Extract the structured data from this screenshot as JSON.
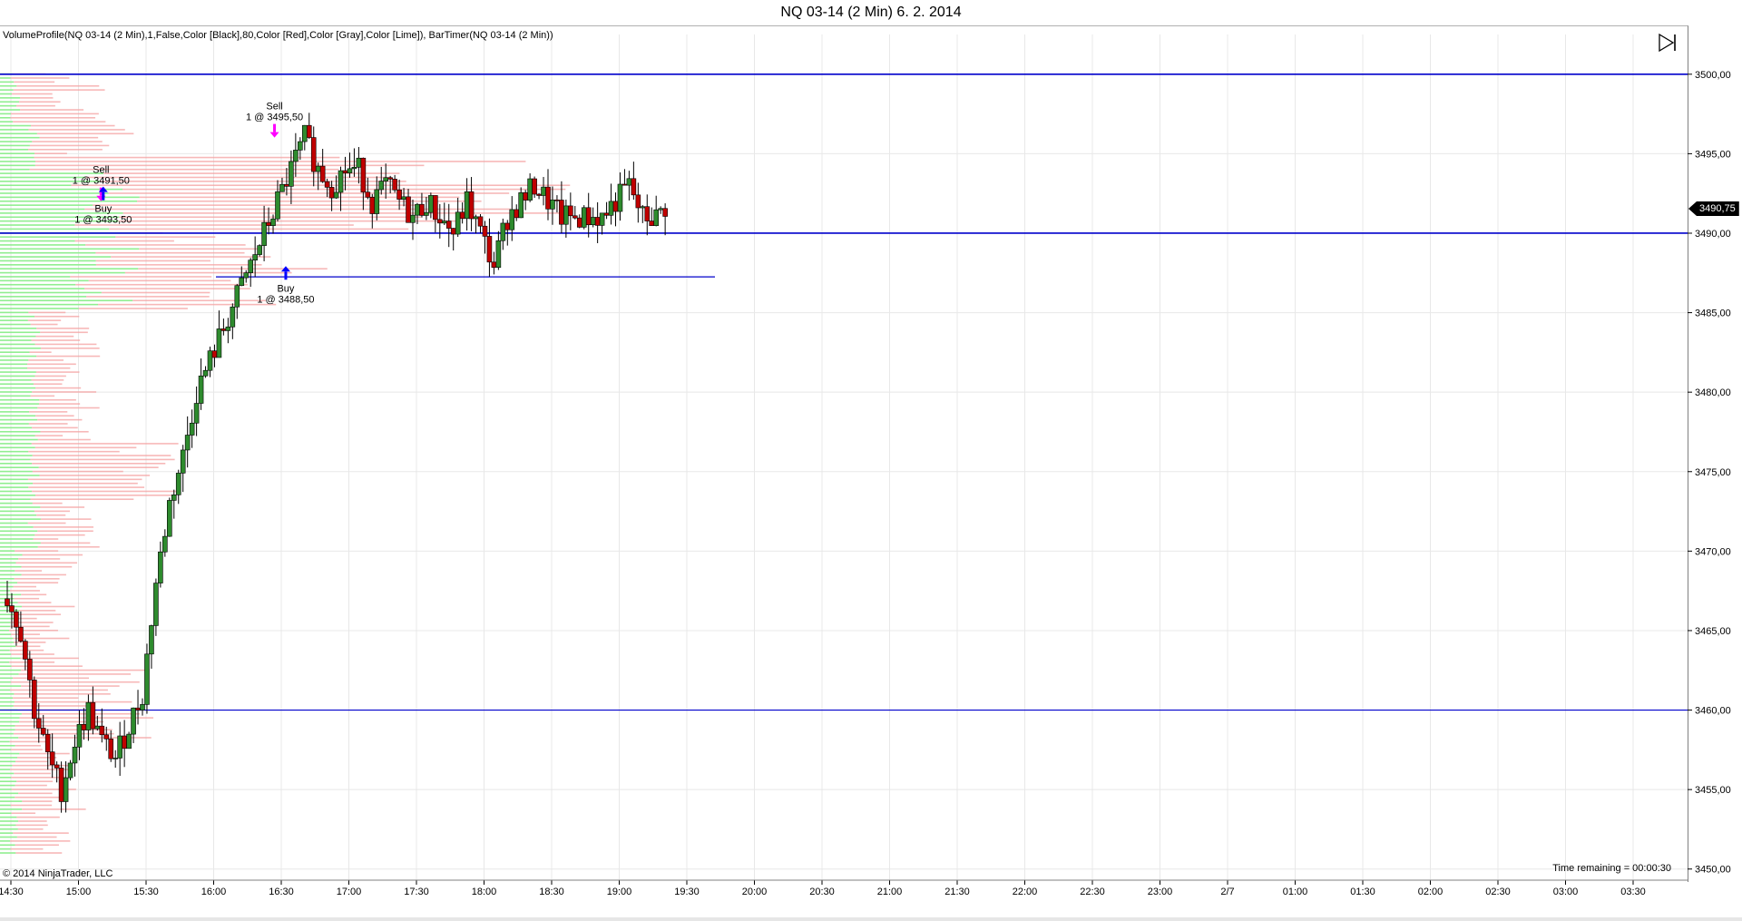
{
  "window": {
    "title": "NQ 03-14 (2 Min)  6. 2. 2014"
  },
  "chart": {
    "indicator_label": "VolumeProfile(NQ 03-14 (2 Min),1,False,Color [Black],80,Color [Red],Color [Gray],Color [Lime]), BarTimer(NQ 03-14 (2 Min))",
    "copyright": "© 2014 NinjaTrader, LLC",
    "time_remaining": "Time remaining = 00:00:30",
    "current_price_label": "3490,75",
    "nav_icon": "skip-to-end-icon",
    "colors": {
      "up_bar": "#2e8b2e",
      "down_bar": "#c00000",
      "profile_buy": "#90ee90",
      "profile_sell": "#f4a0a0",
      "hline": "#0000cc",
      "sell_marker": "#ff00ff",
      "buy_marker": "#0000ff"
    }
  },
  "chart_data": {
    "type": "candlestick",
    "price_axis_ticks": [
      "3500,00",
      "3495,00",
      "3490,00",
      "3485,00",
      "3480,00",
      "3475,00",
      "3470,00",
      "3465,00",
      "3460,00",
      "3455,00",
      "3450,00"
    ],
    "price_axis_values": [
      3500,
      3495,
      3490,
      3485,
      3480,
      3475,
      3470,
      3465,
      3460,
      3455,
      3450
    ],
    "time_axis_ticks": [
      "14:30",
      "15:00",
      "15:30",
      "16:00",
      "16:30",
      "17:00",
      "17:30",
      "18:00",
      "18:30",
      "19:00",
      "19:30",
      "20:00",
      "20:30",
      "21:00",
      "21:30",
      "22:00",
      "22:30",
      "23:00",
      "2/7",
      "01:00",
      "01:30",
      "02:00",
      "02:30",
      "03:00",
      "03:30"
    ],
    "ylim": [
      3449.3,
      3502.5
    ],
    "horizontal_lines": [
      3500.0,
      3490.0,
      3460.0,
      3487.25
    ],
    "close_path": [
      [
        0,
        3467
      ],
      [
        6,
        3465
      ],
      [
        12,
        3460
      ],
      [
        18,
        3457
      ],
      [
        24,
        3455
      ],
      [
        30,
        3458
      ],
      [
        36,
        3460
      ],
      [
        42,
        3458
      ],
      [
        48,
        3457
      ],
      [
        54,
        3459
      ],
      [
        60,
        3461
      ],
      [
        66,
        3468
      ],
      [
        72,
        3473
      ],
      [
        78,
        3476
      ],
      [
        84,
        3480
      ],
      [
        90,
        3482
      ],
      [
        96,
        3484
      ],
      [
        102,
        3486
      ],
      [
        108,
        3488
      ],
      [
        114,
        3490
      ],
      [
        120,
        3492
      ],
      [
        126,
        3494
      ],
      [
        132,
        3496
      ],
      [
        138,
        3494
      ],
      [
        144,
        3493
      ],
      [
        150,
        3494
      ],
      [
        156,
        3494
      ],
      [
        162,
        3492
      ],
      [
        168,
        3493
      ],
      [
        174,
        3492
      ],
      [
        180,
        3491
      ],
      [
        186,
        3492
      ],
      [
        192,
        3491
      ],
      [
        198,
        3490
      ],
      [
        204,
        3492
      ],
      [
        210,
        3490
      ],
      [
        216,
        3488
      ],
      [
        222,
        3491
      ],
      [
        228,
        3492
      ],
      [
        234,
        3493
      ],
      [
        240,
        3492
      ],
      [
        246,
        3491
      ],
      [
        252,
        3491
      ],
      [
        258,
        3491
      ],
      [
        264,
        3491
      ],
      [
        270,
        3492
      ],
      [
        276,
        3493
      ],
      [
        282,
        3491
      ],
      [
        288,
        3491
      ],
      [
        294,
        3492
      ]
    ],
    "trades": [
      {
        "side": "Sell",
        "label": "Sell",
        "detail": "1 @ 3495,50",
        "price": 3495.5,
        "minute": 117
      },
      {
        "side": "Sell",
        "label": "Sell",
        "detail": "1 @ 3491,50",
        "price": 3491.5,
        "minute": 40
      },
      {
        "side": "Buy",
        "label": "Buy",
        "detail": "1 @ 3493,50",
        "price": 3493.5,
        "minute": 41
      },
      {
        "side": "Buy",
        "label": "Buy",
        "detail": "1 @ 3488,50",
        "price": 3488.5,
        "minute": 122
      }
    ]
  }
}
